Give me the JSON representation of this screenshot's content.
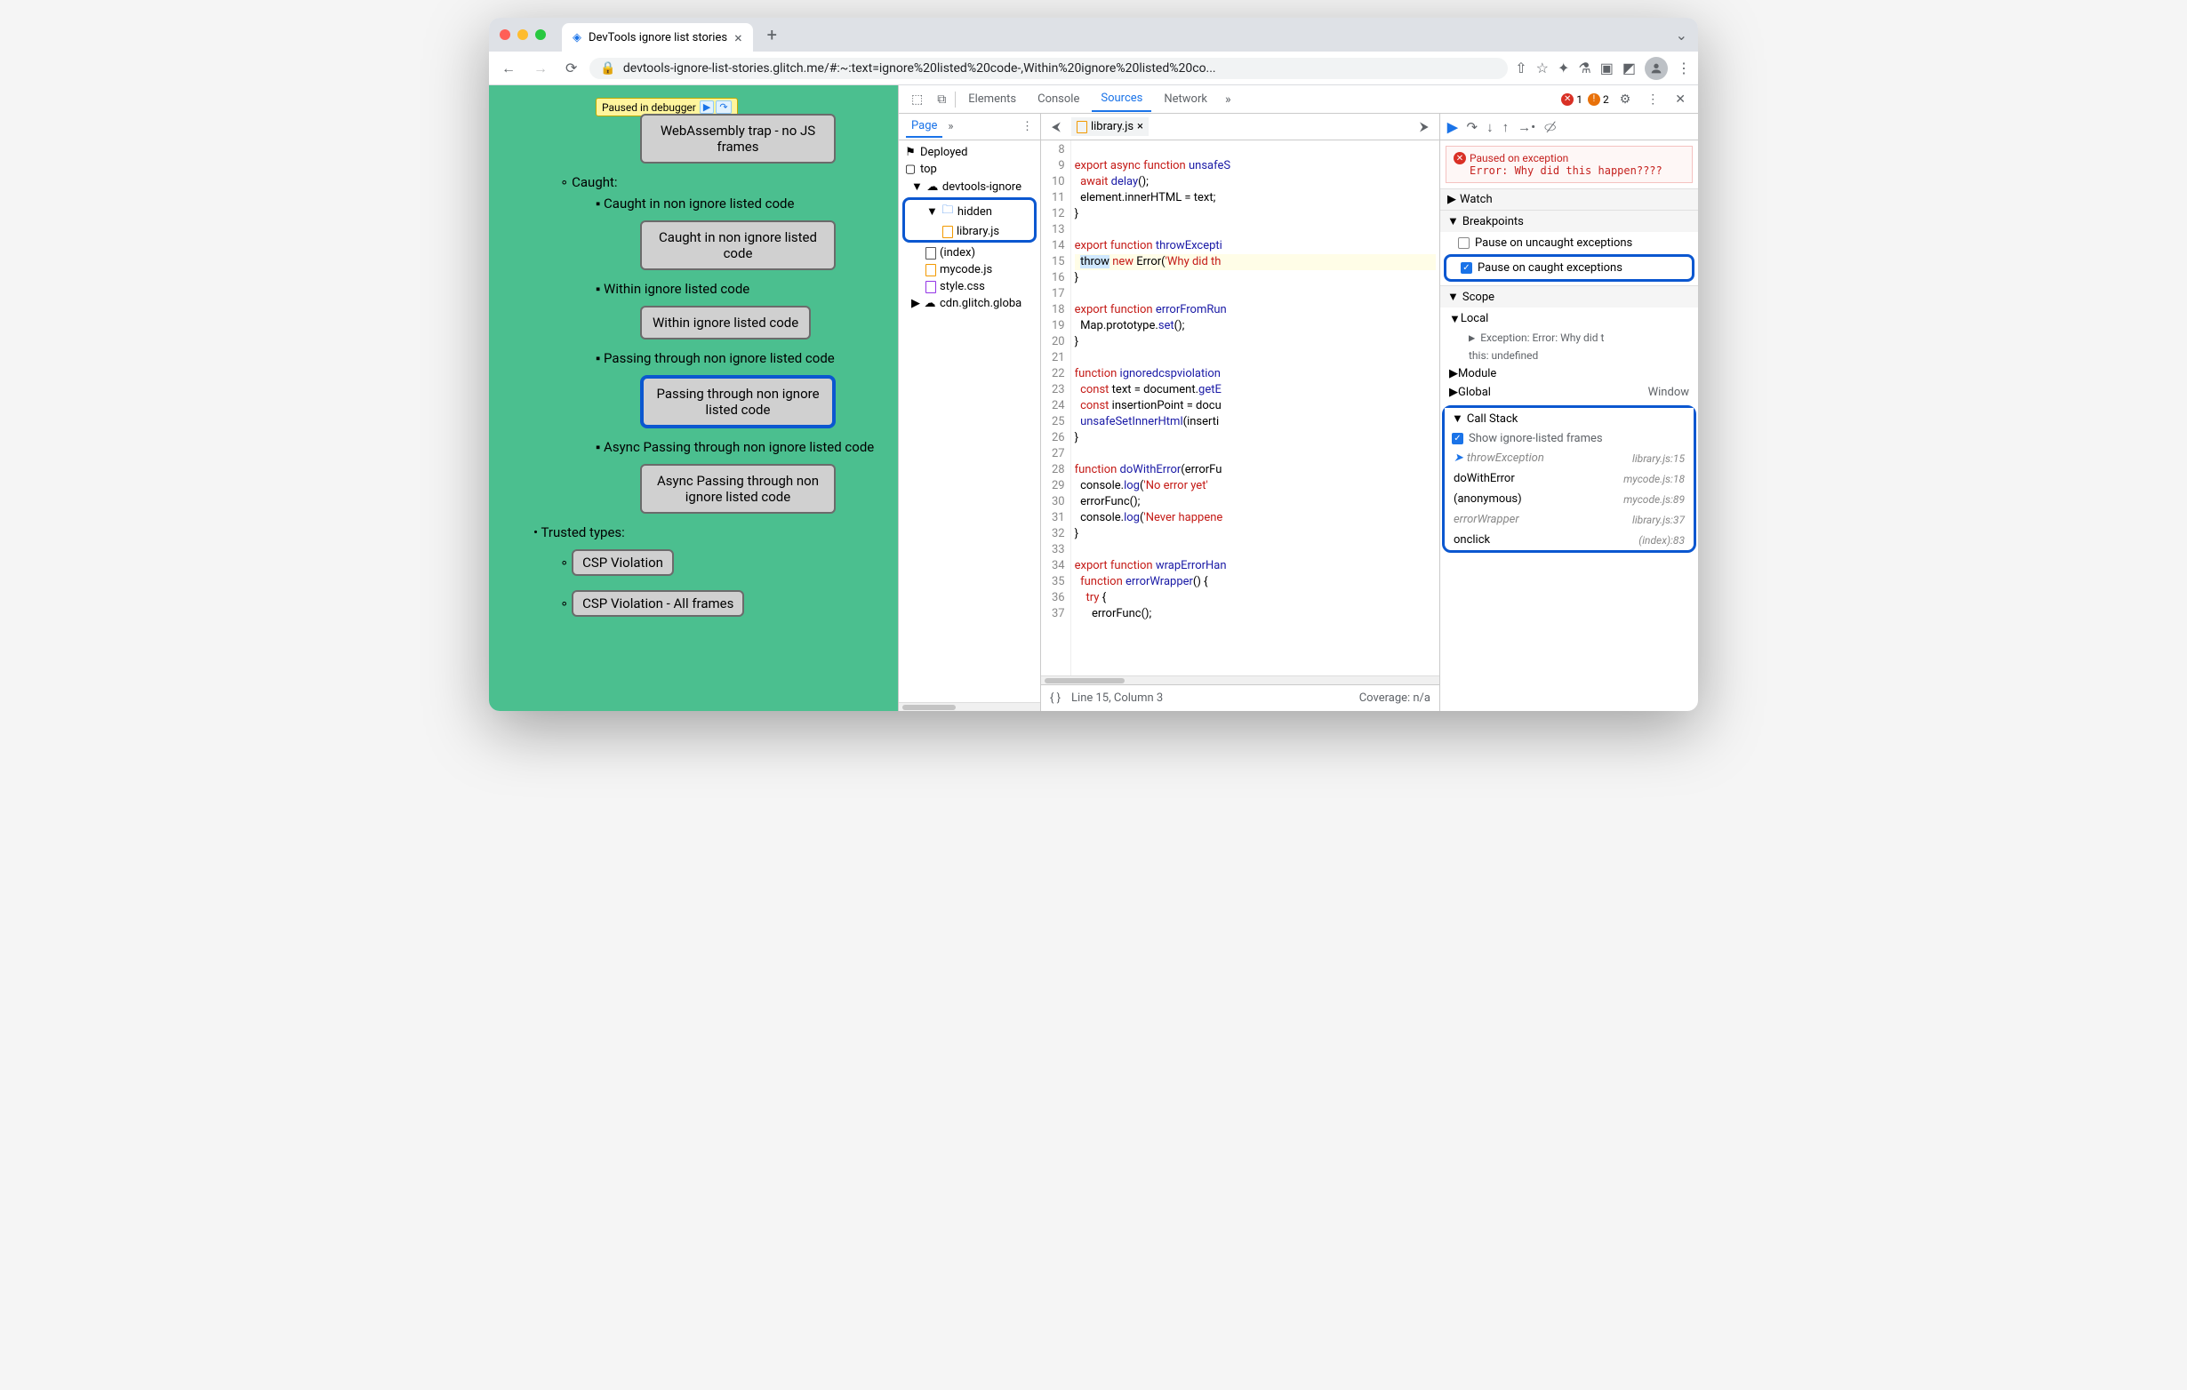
{
  "titlebar": {
    "tab_title": "DevTools ignore list stories",
    "traffic": {
      "close": "#ff5f57",
      "min": "#febc2e",
      "max": "#28c840"
    }
  },
  "toolbar": {
    "url": "devtools-ignore-list-stories.glitch.me/#:~:text=ignore%20listed%20code-,Within%20ignore%20listed%20co..."
  },
  "page": {
    "pause_label": "Paused in debugger",
    "items": {
      "wasm_trap": "WebAssembly trap - no JS frames",
      "caught_h": "Caught:",
      "caught_non_ignore_t": "Caught in non ignore listed code",
      "caught_non_ignore_b": "Caught in non ignore listed code",
      "within_t": "Within ignore listed code",
      "within_b": "Within ignore listed code",
      "passing_t": "Passing through non ignore listed code",
      "passing_b": "Passing through non ignore listed code",
      "async_t": "Async Passing through non ignore listed code",
      "async_b": "Async Passing through non ignore listed code",
      "trusted_h": "Trusted types:",
      "csp_b": "CSP Violation",
      "csp_all_b": "CSP Violation - All frames"
    }
  },
  "devtools": {
    "tabs": {
      "elements": "Elements",
      "console": "Console",
      "sources": "Sources",
      "network": "Network"
    },
    "errors": "1",
    "issues": "2",
    "sidebar": {
      "page": "Page",
      "deployed": "Deployed",
      "top": "top",
      "origin": "devtools-ignore",
      "hidden": "hidden",
      "libraryjs": "library.js",
      "index": "(index)",
      "mycode": "mycode.js",
      "stylecss": "style.css",
      "cdn": "cdn.glitch.globa"
    },
    "editor": {
      "file": "library.js",
      "status_line": "Line 15, Column 3",
      "coverage": "Coverage: n/a",
      "lines": [
        {
          "n": 8,
          "h": ""
        },
        {
          "n": 9,
          "h": "export async function unsafeS",
          "cls": [
            "kw-red",
            "",
            "kw-blue",
            "",
            "kw-blue",
            ""
          ]
        },
        {
          "n": 10,
          "h": "  await delay();"
        },
        {
          "n": 11,
          "h": "  element.innerHTML = text;"
        },
        {
          "n": 12,
          "h": "}"
        },
        {
          "n": 13,
          "h": ""
        },
        {
          "n": 14,
          "h": "export function throwExcepti"
        },
        {
          "n": 15,
          "h": "  throw new Error('Why did th",
          "hl": true
        },
        {
          "n": 16,
          "h": "}"
        },
        {
          "n": 17,
          "h": ""
        },
        {
          "n": 18,
          "h": "export function errorFromRun"
        },
        {
          "n": 19,
          "h": "  Map.prototype.set();"
        },
        {
          "n": 20,
          "h": "}"
        },
        {
          "n": 21,
          "h": ""
        },
        {
          "n": 22,
          "h": "function ignoredcspviolation"
        },
        {
          "n": 23,
          "h": "  const text = document.getE"
        },
        {
          "n": 24,
          "h": "  const insertionPoint = docu"
        },
        {
          "n": 25,
          "h": "  unsafeSetInnerHtml(inserti"
        },
        {
          "n": 26,
          "h": "}"
        },
        {
          "n": 27,
          "h": ""
        },
        {
          "n": 28,
          "h": "function doWithError(errorFu"
        },
        {
          "n": 29,
          "h": "  console.log('No error yet'"
        },
        {
          "n": 30,
          "h": "  errorFunc();"
        },
        {
          "n": 31,
          "h": "  console.log('Never happene"
        },
        {
          "n": 32,
          "h": "}"
        },
        {
          "n": 33,
          "h": ""
        },
        {
          "n": 34,
          "h": "export function wrapErrorHan"
        },
        {
          "n": 35,
          "h": "  function errorWrapper() {"
        },
        {
          "n": 36,
          "h": "    try {"
        },
        {
          "n": 37,
          "h": "      errorFunc();"
        }
      ]
    },
    "debugger": {
      "pause_title": "Paused on exception",
      "pause_err": "Error: Why did this happen????",
      "watch": "Watch",
      "breakpoints": "Breakpoints",
      "bp_uncaught": "Pause on uncaught exceptions",
      "bp_caught": "Pause on caught exceptions",
      "scope": "Scope",
      "scope_local": "Local",
      "scope_exception": "Exception: Error: Why did t",
      "scope_this": "this: undefined",
      "scope_module": "Module",
      "scope_global": "Global",
      "scope_global_v": "Window",
      "callstack": "Call Stack",
      "show_ignored": "Show ignore-listed frames",
      "stack": [
        {
          "fn": "throwException",
          "loc": "library.js:15",
          "ignored": true,
          "current": true
        },
        {
          "fn": "doWithError",
          "loc": "mycode.js:18"
        },
        {
          "fn": "(anonymous)",
          "loc": "mycode.js:89"
        },
        {
          "fn": "errorWrapper",
          "loc": "library.js:37",
          "ignored": true
        },
        {
          "fn": "onclick",
          "loc": "(index):83"
        }
      ]
    }
  }
}
